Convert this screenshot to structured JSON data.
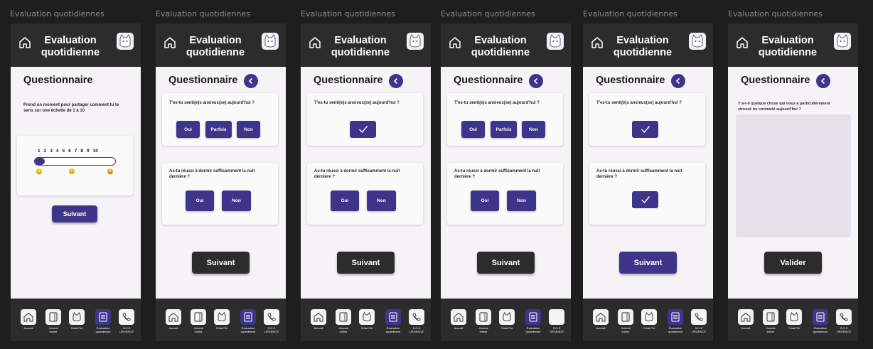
{
  "frame_label": "Evaluation quotidiennes",
  "header": {
    "title": "Evaluation quotidienne"
  },
  "questionnaire_title": "Questionnaire",
  "intro_text": "Prend un moment pour partager comment tu te sens sur une échelle de 1 à 10",
  "scale": {
    "numbers": "1 2 3 4 5 6 7 8 9 10",
    "value": 1,
    "max": 10,
    "emojis": [
      "😞",
      "😐",
      "😄"
    ]
  },
  "q1": {
    "text": "T'es-tu senti(e)s anxieux(se) aujourd'hui ?",
    "options": [
      "Oui",
      "Parfois",
      "Non"
    ]
  },
  "q2": {
    "text": "As-tu réussi à dormir suffisamment la nuit dernière ?",
    "options": [
      "Oui",
      "Non"
    ]
  },
  "q3": {
    "text": "Y a-t-il quelque chose qui vous a particulièrement stressé ou contrarié aujourd'hui ?"
  },
  "buttons": {
    "next": "Suivant",
    "validate": "Valider"
  },
  "nav": [
    {
      "label": "Accueil",
      "icon": "home-icon"
    },
    {
      "label": "Journal\nintime",
      "icon": "journal-icon"
    },
    {
      "label": "Tchat Pet",
      "icon": "cat-icon"
    },
    {
      "label": "Évaluation\nquotidienne",
      "icon": "checklist-icon"
    },
    {
      "label": "S.O.S\nURGENCE",
      "icon": "phone-icon"
    }
  ],
  "colors": {
    "accent": "#3e358b",
    "dark": "#2c2c2c",
    "screen_bg": "#f6f3f6"
  }
}
